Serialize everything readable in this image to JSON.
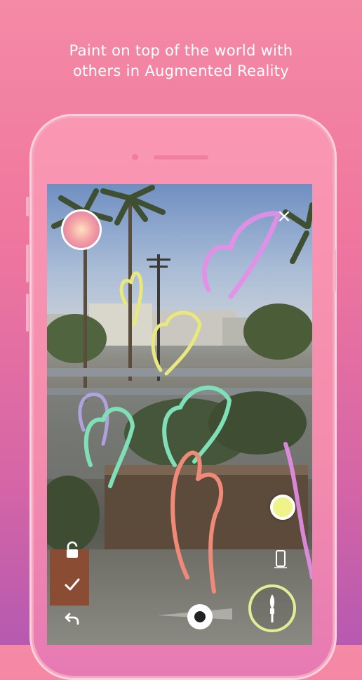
{
  "headline": {
    "line1": "Paint on top of the world with",
    "line2": "others in Augmented Reality"
  },
  "controls": {
    "avatar": "avatar-icon",
    "close": "×",
    "lock": "lock-icon",
    "confirm": "check-icon",
    "undo": "undo-icon",
    "device_mode": "phone-icon",
    "color_picker": "color-picker",
    "brush_size": "brush-size-slider",
    "brush": "brush-icon"
  },
  "colors": {
    "background_top": "#f48aa6",
    "background_bottom": "#b65ab0",
    "stroke_yellow": "#e9e87c",
    "stroke_pink": "#e58ee7",
    "stroke_green": "#7fe0b8",
    "stroke_coral": "#f08a78",
    "stroke_lavender": "#b9a9f0",
    "selected_color": "#f0f28a",
    "brush_ring": "#e2ee96"
  }
}
